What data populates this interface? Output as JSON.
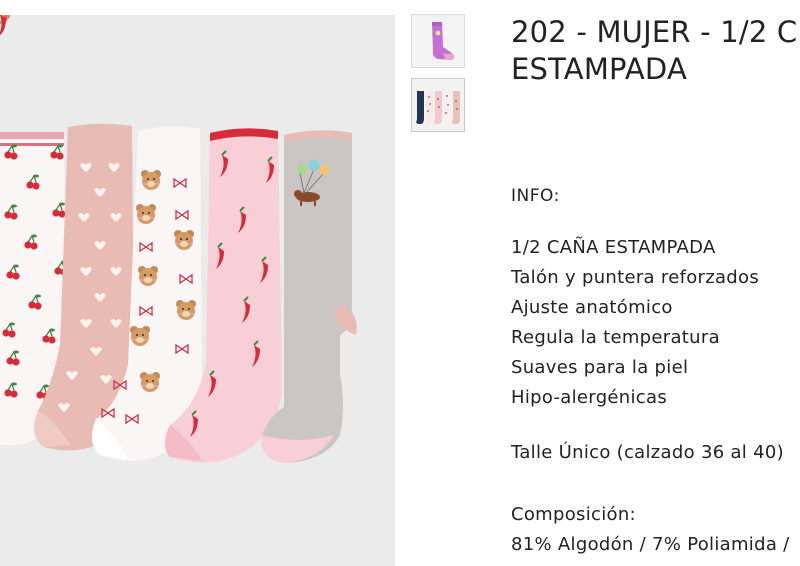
{
  "product": {
    "title_line1": "202 - MUJER - 1/2 C",
    "title_line2": "ESTAMPADA",
    "info_label": "INFO:",
    "features": [
      "1/2 CAÑA ESTAMPADA",
      "Talón y puntera reforzados",
      "Ajuste anatómico",
      "Regula la temperatura",
      "Suaves para la piel",
      "Hipo-alergénicas"
    ],
    "size": "Talle Único (calzado 36 al 40)",
    "composition_label": "Composición:",
    "composition_value": "81% Algodón / 7% Poliamida /"
  },
  "gallery": {
    "thumbnails": [
      "purple-sock-thumbnail",
      "five-socks-thumbnail"
    ],
    "selected": 1
  },
  "colors": {
    "background": "#ffffff",
    "image_bg": "#ebebec",
    "sock_pink": "#e8bcb2",
    "sock_white": "#fbf6f6",
    "sock_light_pink": "#f8cfd6",
    "sock_grey": "#c9c6c4",
    "accent_red": "#d62b3a",
    "thumb_purple": "#c36fd3"
  }
}
